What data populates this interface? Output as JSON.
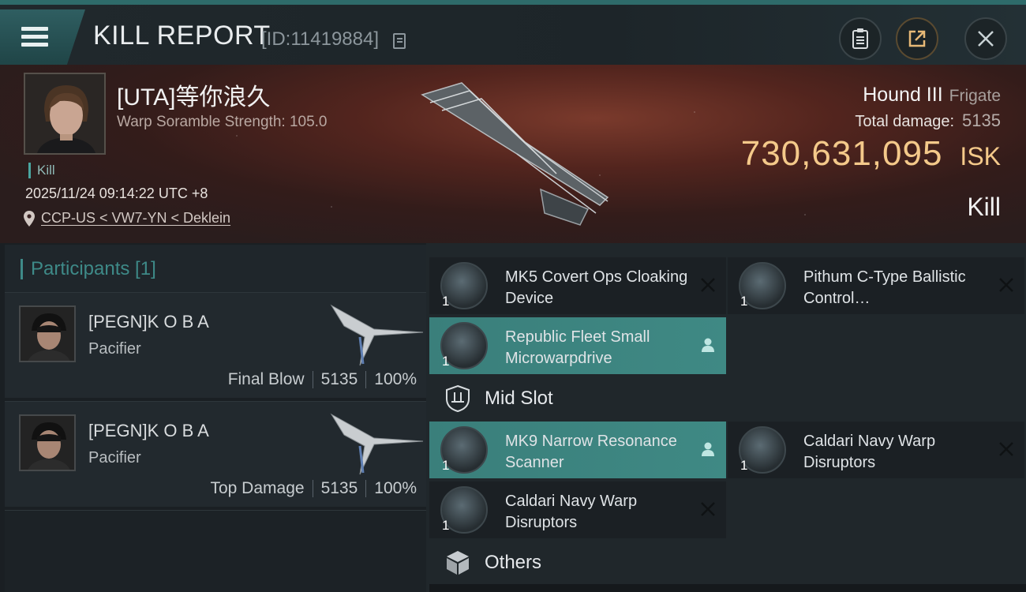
{
  "header": {
    "title": "KILL REPORT",
    "report_id": "[ID:11419884]"
  },
  "victim": {
    "name": "[UTA]等你浪久",
    "scramble": "Warp Soramble Strength: 105.0",
    "kill_tag": "Kill",
    "datetime": "2025/11/24 09:14:22 UTC +8",
    "location": "CCP-US < VW7-YN < Deklein",
    "ship_name": "Hound III",
    "ship_class": "Frigate",
    "total_damage_label": "Total damage:",
    "total_damage": "5135",
    "isk_value": "730,631,095",
    "isk_unit": "ISK",
    "result": "Kill"
  },
  "participants": {
    "header": "Participants [1]",
    "items": [
      {
        "name": "[PEGN]K O B A",
        "ship": "Pacifier",
        "role": "Final Blow",
        "damage": "5135",
        "percent": "100%"
      },
      {
        "name": "[PEGN]K O B A",
        "ship": "Pacifier",
        "role": "Top Damage",
        "damage": "5135",
        "percent": "100%"
      }
    ]
  },
  "fitting": {
    "low_slots": [
      {
        "name": "MK5 Covert Ops Cloaking Device",
        "qty": "1",
        "status": "destroyed",
        "active": false
      },
      {
        "name": "Pithum C-Type Ballistic Control…",
        "qty": "1",
        "status": "destroyed",
        "active": false
      },
      {
        "name": "Republic Fleet Small Microwarpdrive",
        "qty": "1",
        "status": "dropped",
        "active": true
      }
    ],
    "mid_slot_label": "Mid Slot",
    "mid_slots": [
      {
        "name": "MK9 Narrow Resonance Scanner",
        "qty": "1",
        "status": "dropped",
        "active": true
      },
      {
        "name": "Caldari Navy Warp Disruptors",
        "qty": "1",
        "status": "destroyed",
        "active": false
      },
      {
        "name": "Caldari Navy Warp Disruptors",
        "qty": "1",
        "status": "destroyed",
        "active": false
      }
    ],
    "others_label": "Others"
  },
  "icons": {
    "menu": "hamburger-menu-icon",
    "copy": "copy-icon",
    "clipboard": "clipboard-icon",
    "share": "share-icon",
    "close": "close-icon",
    "location": "location-pin-icon",
    "mid_slot": "shield-slot-icon",
    "others": "cube-icon",
    "destroyed": "x-mark-icon",
    "dropped": "person-icon"
  },
  "colors": {
    "accent_teal": "#3f8984",
    "isk_gold": "#f4c98a",
    "background": "#1b2126"
  }
}
